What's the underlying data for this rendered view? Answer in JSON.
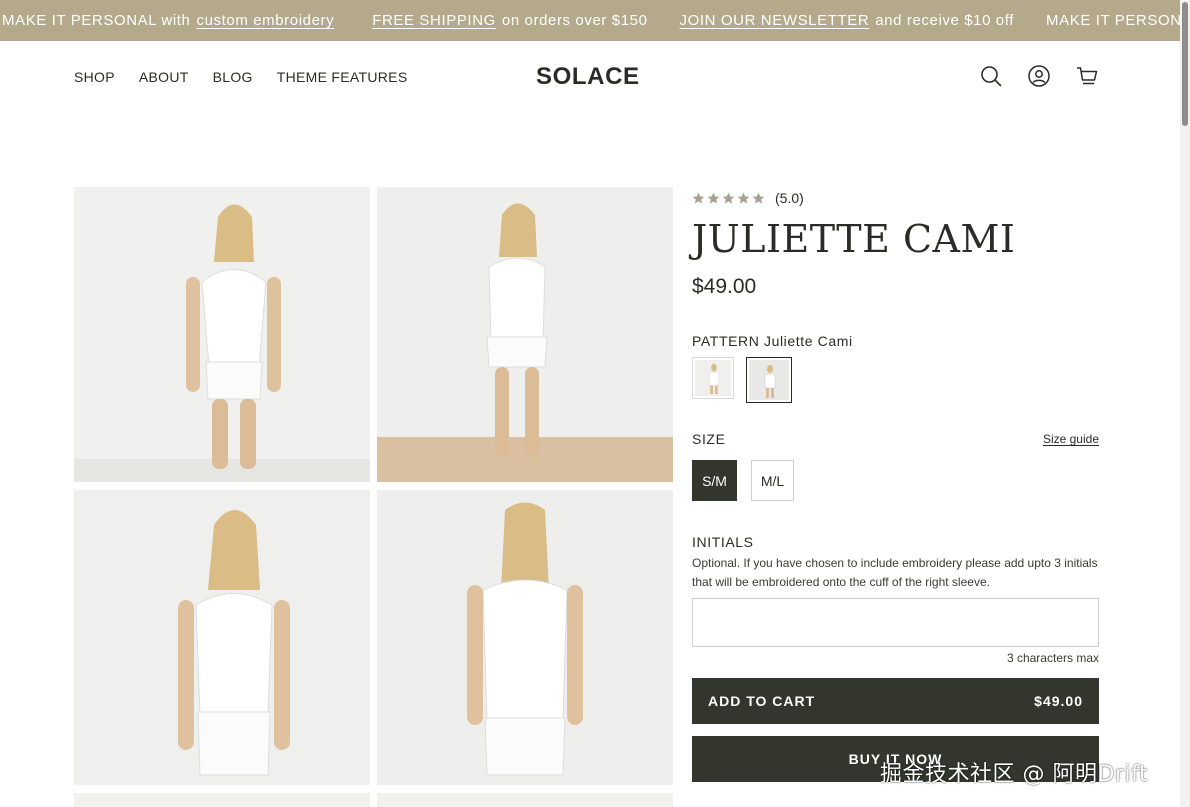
{
  "announcement": {
    "items": [
      {
        "prefix": "MAKE IT PERSONAL with",
        "link": "custom embroidery",
        "suffix": ""
      },
      {
        "prefix": "",
        "link": "FREE SHIPPING",
        "suffix": "on orders over $150"
      },
      {
        "prefix": "",
        "link": "JOIN OUR NEWSLETTER",
        "suffix": "and receive $10 off"
      },
      {
        "prefix": "MAKE IT PERSON",
        "link": "",
        "suffix": ""
      }
    ]
  },
  "header": {
    "nav": [
      "SHOP",
      "ABOUT",
      "BLOG",
      "THEME FEATURES"
    ],
    "logo": "SOLACE",
    "icons": [
      "search-icon",
      "account-icon",
      "cart-icon"
    ]
  },
  "product": {
    "rating_stars": 5,
    "rating_text": "(5.0)",
    "title": "JULIETTE CAMI",
    "price": "$49.00",
    "pattern_label": "PATTERN",
    "pattern_value": "Juliette Cami",
    "size_label": "SIZE",
    "size_guide": "Size guide",
    "sizes": [
      "S/M",
      "M/L"
    ],
    "selected_size": "S/M",
    "initials_label": "INITIALS",
    "initials_help": "Optional. If you have chosen to include embroidery please add upto 3 initials that will be embroidered onto the cuff of the right sleeve.",
    "initials_value": "",
    "char_max": "3 characters max",
    "add_to_cart": "ADD TO CART",
    "add_to_cart_price": "$49.00",
    "buy_now": "BUY IT NOW"
  },
  "colors": {
    "announcement_bg": "#b5a98b",
    "button_bg": "#33362d",
    "star": "#a7a18f"
  },
  "watermark": "掘金技术社区 @ 阿明Drift"
}
